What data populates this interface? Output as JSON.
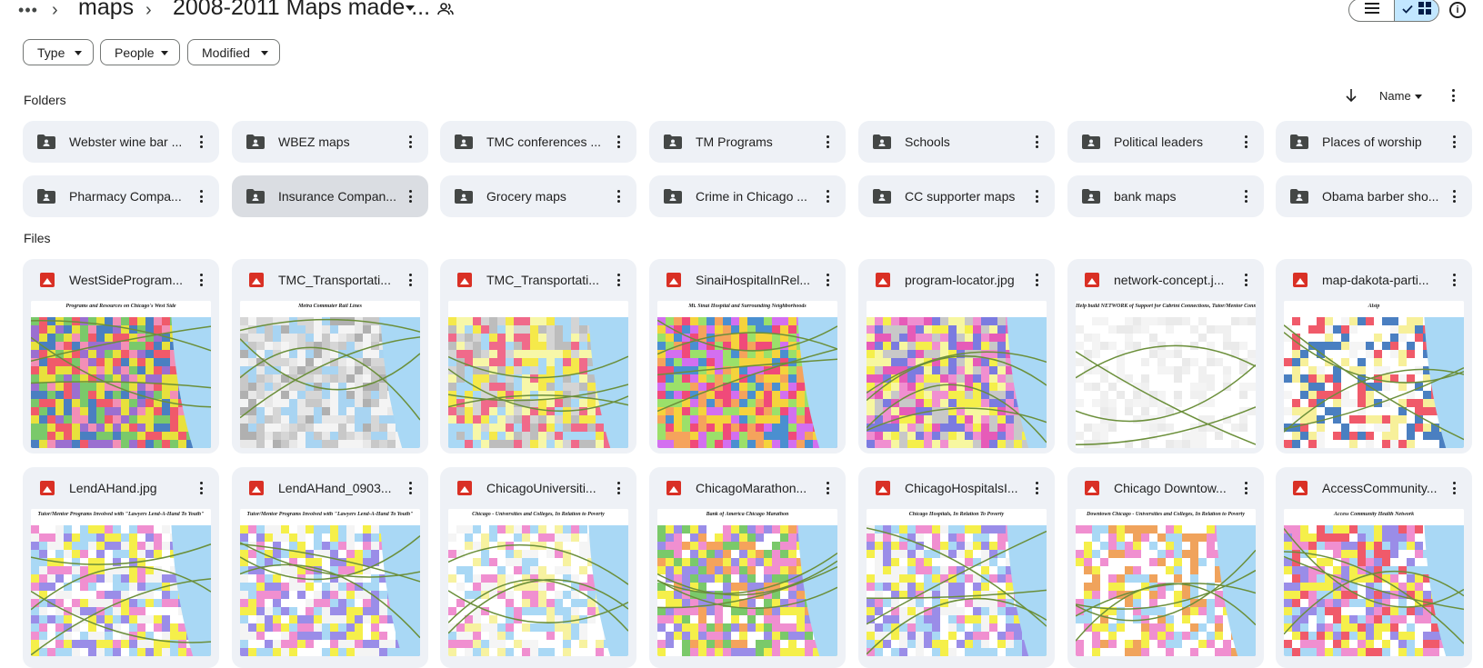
{
  "breadcrumb": {
    "parent": "maps",
    "current": "2008-2011 Maps made ..."
  },
  "filters": {
    "type_label": "Type",
    "people_label": "People",
    "modified_label": "Modified"
  },
  "sections": {
    "folders_label": "Folders",
    "files_label": "Files"
  },
  "sort": {
    "label": "Name"
  },
  "folders": [
    {
      "name": "Webster wine bar ..."
    },
    {
      "name": "WBEZ maps"
    },
    {
      "name": "TMC conferences ..."
    },
    {
      "name": "TM Programs"
    },
    {
      "name": "Schools"
    },
    {
      "name": "Political leaders"
    },
    {
      "name": "Places of worship"
    },
    {
      "name": "Pharmacy Compa..."
    },
    {
      "name": "Insurance Compan..."
    },
    {
      "name": "Grocery maps"
    },
    {
      "name": "Crime in Chicago ..."
    },
    {
      "name": "CC supporter maps"
    },
    {
      "name": "bank maps"
    },
    {
      "name": "Obama barber sho..."
    }
  ],
  "files": [
    {
      "name": "WestSideProgram...",
      "thumb_title": "Programs and Resources on Chicago's West Side"
    },
    {
      "name": "TMC_Transportati...",
      "thumb_title": "Metra Commuter Rail Lines"
    },
    {
      "name": "TMC_Transportati...",
      "thumb_title": ""
    },
    {
      "name": "SinaiHospitalInRel...",
      "thumb_title": "Mt. Sinai Hospital and Surrounding Neighborhoods"
    },
    {
      "name": "program-locator.jpg",
      "thumb_title": ""
    },
    {
      "name": "network-concept.j...",
      "thumb_title": "Help build NETWORK of Support for Cabrini Connections, Tutor/Mentor Connection"
    },
    {
      "name": "map-dakota-parti...",
      "thumb_title": "Alsip"
    },
    {
      "name": "LendAHand.jpg",
      "thumb_title": "Tutor/Mentor Programs Involved with \"Lawyers Lend-A-Hand To Youth\""
    },
    {
      "name": "LendAHand_0903...",
      "thumb_title": "Tutor/Mentor Programs Involved with \"Lawyers Lend-A-Hand To Youth\""
    },
    {
      "name": "ChicagoUniversiti...",
      "thumb_title": "Chicago - Universities and Colleges, In Relation to Poverty"
    },
    {
      "name": "ChicagoMarathon...",
      "thumb_title": "Bank of America Chicago Marathon"
    },
    {
      "name": "ChicagoHospitalsI...",
      "thumb_title": "Chicago Hospitals, In Relation To Poverty"
    },
    {
      "name": "Chicago Downtow...",
      "thumb_title": "Downtown Chicago - Universities and Colleges, In Relation to Poverty"
    },
    {
      "name": "AccessCommunity...",
      "thumb_title": "Access Community Health Network"
    }
  ],
  "colors": {
    "card_bg": "#eef1f6",
    "selected_card_bg": "#dadde2",
    "toggle_active": "#c2e7ff",
    "image_icon": "#d93025"
  },
  "icons": {
    "more": "more-horizontal-icon",
    "chevron": "chevron-right-icon",
    "share": "people-icon",
    "list_view": "list-view-icon",
    "grid_view": "grid-view-icon",
    "info": "info-icon",
    "folder": "shared-folder-icon",
    "image": "image-file-icon",
    "kebab": "more-vert-icon",
    "sort": "arrow-down-icon"
  }
}
